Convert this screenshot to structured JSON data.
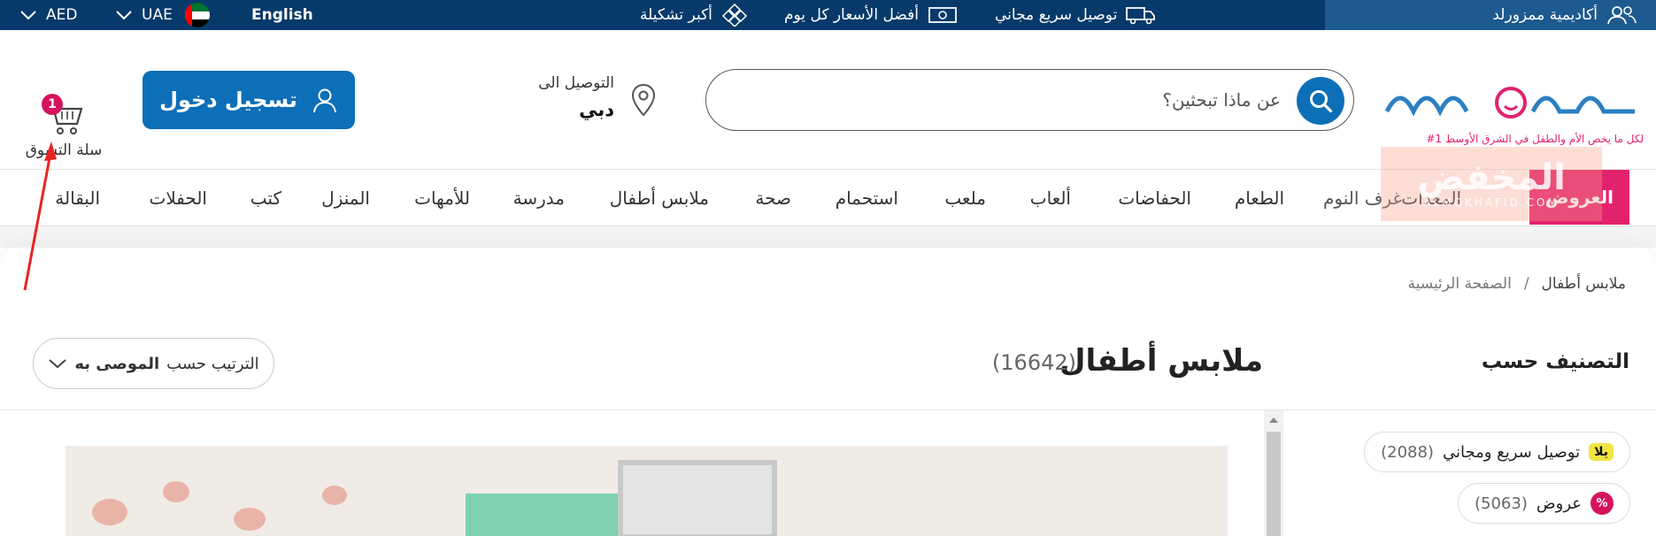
{
  "topbar": {
    "academy": "أكاديمية ممزورلد",
    "free_delivery": "توصيل سريع مجاني",
    "best_prices": "أفضل الأسعار كل يوم",
    "largest_selection": "أكبر تشكيلة",
    "language": "English",
    "country": "UAE",
    "currency": "AED"
  },
  "header": {
    "logo_text": "ممزورلد",
    "logo_tagline": "#1 لكل ما يخص الأم والطفل في الشرق الأوسط",
    "search_placeholder": "عن ماذا تبحثين؟",
    "deliver_to_label": "التوصيل الى",
    "deliver_to_city": "دبي",
    "login_label": "تسجيل دخول",
    "cart_label": "سلة التسوق",
    "cart_count": "1"
  },
  "nav": {
    "items": [
      "العروض",
      "المعدات",
      "غرف النوم",
      "الطعام",
      "الحفاضات",
      "ألعاب",
      "ملعب",
      "استحمام",
      "صحة",
      "ملابس أطفال",
      "مدرسة",
      "للأمهات",
      "المنزل",
      "كتب",
      "الحفلات",
      "البقالة"
    ]
  },
  "watermark": {
    "main": "المخفض",
    "sub": "ALMOKHAFID.COM"
  },
  "breadcrumb": {
    "home": "الصفحة الرئيسية",
    "separator": "/",
    "current": "ملابس أطفال"
  },
  "listing": {
    "title": "ملابس أطفال",
    "count": "(16642)",
    "sort_label": "الترتيب حسب",
    "sort_value": "الموصى به",
    "classify_heading": "التصنيف حسب"
  },
  "filters": [
    {
      "badge": "يلا",
      "label": "توصيل سريع ومجاني",
      "count": "(2088)"
    },
    {
      "badge": "%",
      "label": "عروض",
      "count": "(5063)"
    }
  ],
  "colors": {
    "brand_blue": "#0d6fb8",
    "topbar": "#073a6a",
    "offers_pink": "#e3226d",
    "badge": "#d6145e"
  }
}
